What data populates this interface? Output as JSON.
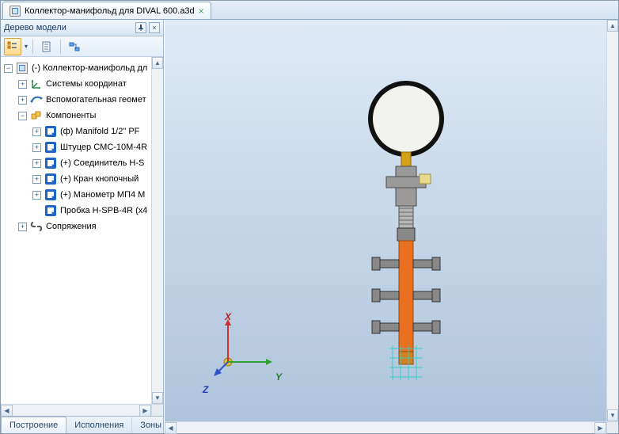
{
  "document_tab": {
    "title": "Коллектор-манифольд для DIVAL 600.a3d"
  },
  "panel": {
    "title": "Дерево модели",
    "toolbar_dropdown": "▾"
  },
  "tree": {
    "root_label": "(-) Коллектор-манифольд дл",
    "coord_label": "Системы координат",
    "geom_label": "Вспомогательная геомет",
    "comp_label": "Компоненты",
    "mate_label": "Сопряжения",
    "components": [
      {
        "label": "(ф) Manifold 1/2\" PF"
      },
      {
        "label": "Штуцер CMC-10M-4R"
      },
      {
        "label": "(+) Соединитель H-S"
      },
      {
        "label": "(+) Кран кнопочный"
      },
      {
        "label": "(+) Манометр МП4 М"
      },
      {
        "label": "Пробка H-SPB-4R (x4"
      }
    ]
  },
  "bottom_tabs": {
    "build": "Построение",
    "exec": "Исполнения",
    "zones": "Зоны"
  },
  "axes": {
    "x": "X",
    "y": "Y",
    "z": "Z"
  }
}
